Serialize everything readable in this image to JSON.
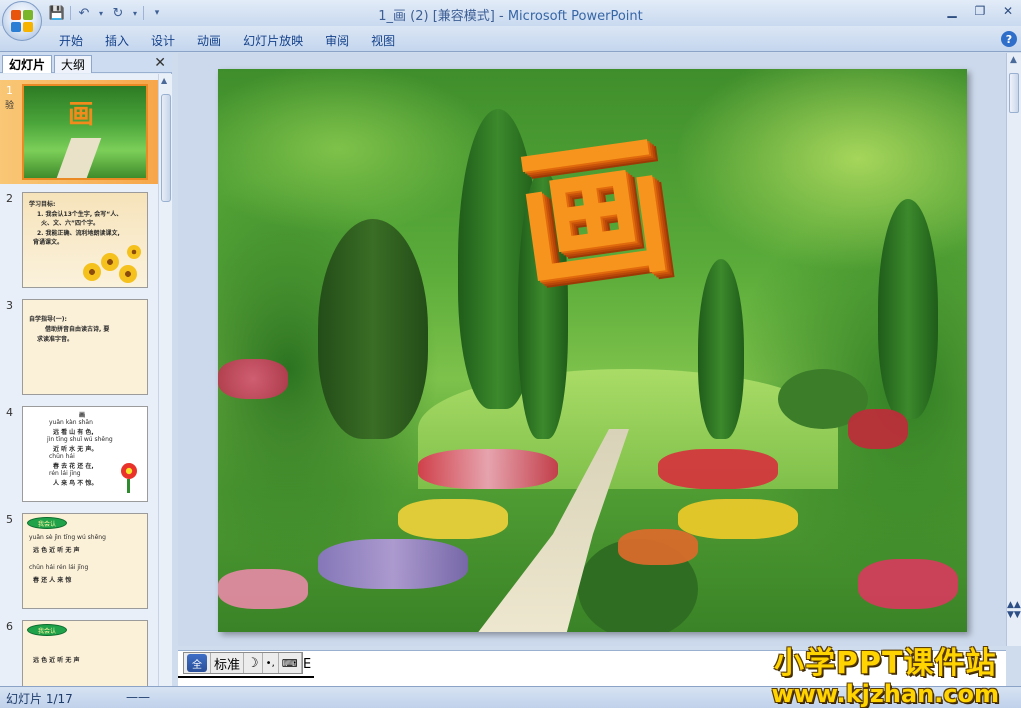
{
  "window": {
    "title_doc": "1_画 (2) [兼容模式] - ",
    "title_app": "Microsoft PowerPoint"
  },
  "qat": {
    "undo_icon": "undo-icon",
    "redo_icon": "redo-icon"
  },
  "ribbon": {
    "tabs": [
      "开始",
      "插入",
      "设计",
      "动画",
      "幻灯片放映",
      "审阅",
      "视图"
    ]
  },
  "panel": {
    "tab_slides": "幻灯片",
    "tab_outline": "大纲"
  },
  "slides": [
    {
      "num": "1",
      "anim_mark": "验",
      "char": "画"
    },
    {
      "num": "2",
      "lines": [
        "学习目标:",
        "1. 我会认13个生字, 会写“人、",
        "火、文、六”四个字。",
        "2. 我能正确、流利地朗读课文,",
        "背诵课文。"
      ]
    },
    {
      "num": "3",
      "lines": [
        "自学指导(一):",
        "借助拼音自由读古诗, 要",
        "求读准字音。"
      ]
    },
    {
      "num": "4",
      "lines": [
        "画",
        "yuǎn kàn  shān",
        "远 看 山 有 色,",
        "jìn  tīng  shuǐ wú shēng",
        "近 听 水 无 声。",
        "chūn        hái",
        "春 去 花 还 在,",
        "rén lái       jīng",
        "人 来 鸟 不 惊。"
      ]
    },
    {
      "num": "5",
      "badge": "我会认",
      "lines": [
        "yuǎn sè  jìn tīng wú shēng",
        "远  色  近  听  无  声",
        "chūn  hái  rén   lái jīng",
        "春  还  人  来  惊"
      ]
    },
    {
      "num": "6",
      "badge": "我会认",
      "lines": [
        "远  色  近  听  无  声"
      ]
    }
  ],
  "ime": {
    "mode": "标准",
    "moon_icon": "moon-icon",
    "punct": "•,",
    "keyboard_icon": "keyboard-icon",
    "trail": "E"
  },
  "status": {
    "slide_indicator": "幻灯片 1/17",
    "dash": "——"
  },
  "watermark": {
    "line1": "小学PPT课件站",
    "line2": "www.kjzhan.com"
  },
  "colors": {
    "accent_orange": "#f7941d",
    "ribbon_blue": "#15428b"
  }
}
